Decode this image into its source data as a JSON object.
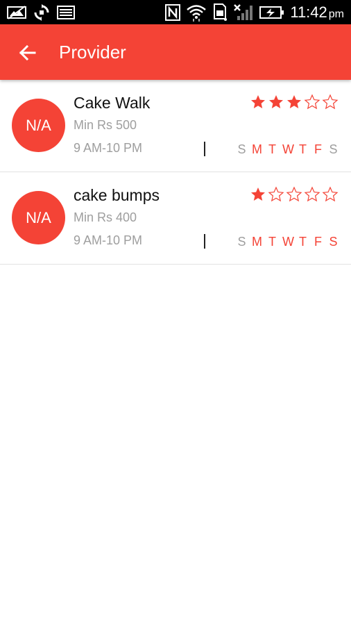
{
  "status_bar": {
    "time": "11:42",
    "ampm": "pm",
    "icons": [
      "image-icon",
      "sync-icon",
      "gallery-icon",
      "nfc-icon",
      "wifi-icon",
      "sd-card-icon",
      "no-signal-icon",
      "battery-charging-icon"
    ]
  },
  "app_bar": {
    "title": "Provider",
    "back_icon": "arrow-left-icon"
  },
  "providers": [
    {
      "avatar_text": "N/A",
      "name": "Cake Walk",
      "min_price": "Min Rs 500",
      "hours": "9 AM-10 PM",
      "rating": 3,
      "max_rating": 5,
      "days": [
        {
          "letter": "S",
          "active": false
        },
        {
          "letter": "M",
          "active": true
        },
        {
          "letter": "T",
          "active": true
        },
        {
          "letter": "W",
          "active": true
        },
        {
          "letter": "T",
          "active": true
        },
        {
          "letter": "F",
          "active": true
        },
        {
          "letter": "S",
          "active": false
        }
      ]
    },
    {
      "avatar_text": "N/A",
      "name": "cake bumps",
      "min_price": "Min Rs 400",
      "hours": "9 AM-10 PM",
      "rating": 1,
      "max_rating": 5,
      "days": [
        {
          "letter": "S",
          "active": false
        },
        {
          "letter": "M",
          "active": true
        },
        {
          "letter": "T",
          "active": true
        },
        {
          "letter": "W",
          "active": true
        },
        {
          "letter": "T",
          "active": true
        },
        {
          "letter": "F",
          "active": true
        },
        {
          "letter": "S",
          "active": true
        }
      ]
    }
  ],
  "colors": {
    "accent": "#f44336",
    "inactive_day": "#9e9e9e",
    "secondary_text": "#9e9e9e"
  }
}
